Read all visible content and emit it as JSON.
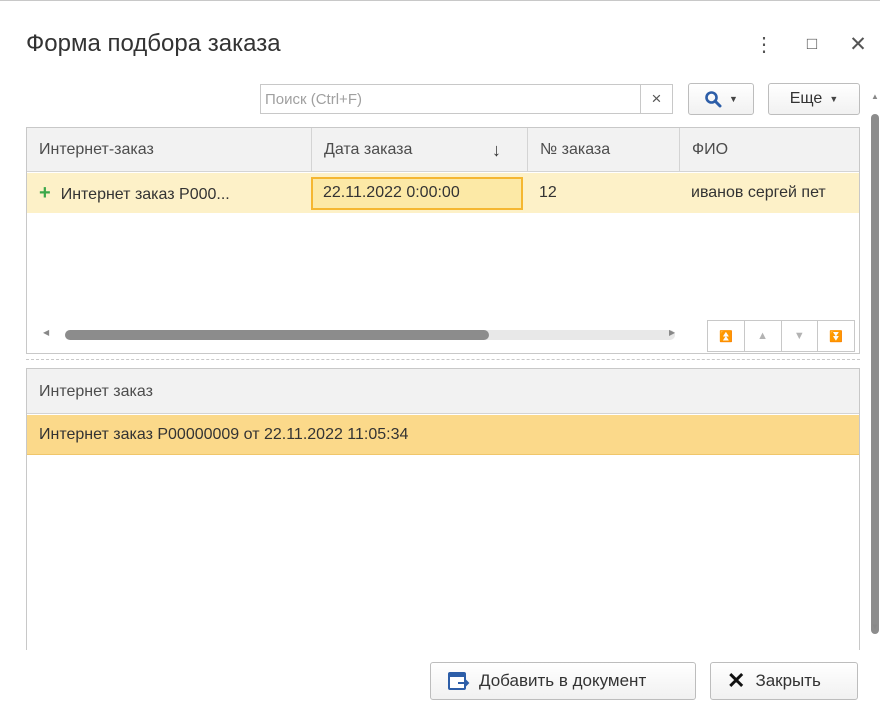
{
  "window": {
    "title": "Форма подбора заказа",
    "more_icon": "⋮",
    "maximize_icon": "□",
    "close_icon": "✕"
  },
  "search": {
    "placeholder": "Поиск (Ctrl+F)",
    "value": "",
    "clear_icon": "×",
    "search_icon": "magnifier-icon",
    "more_label": "Еще"
  },
  "orders_table": {
    "columns": [
      "Интернет-заказ",
      "Дата заказа",
      "№ заказа",
      "ФИО"
    ],
    "sort_icon": "↓",
    "rows": [
      {
        "order": "Интернет заказ Р000...",
        "date": "22.11.2022 0:00:00",
        "number": "12",
        "fio": "иванов сергей пет"
      }
    ]
  },
  "selected_table": {
    "column": "Интернет заказ",
    "rows": [
      "Интернет заказ Р00000009 от 22.11.2022 11:05:34"
    ]
  },
  "footer": {
    "add_label": "Добавить в документ",
    "close_label": "Закрыть"
  },
  "colors": {
    "row_highlight": "#fdf1c8",
    "row_selected": "#fbd98a",
    "focus_border": "#f5b731",
    "search_accent": "#2d5ea8",
    "plus_green": "#3ba84a"
  }
}
